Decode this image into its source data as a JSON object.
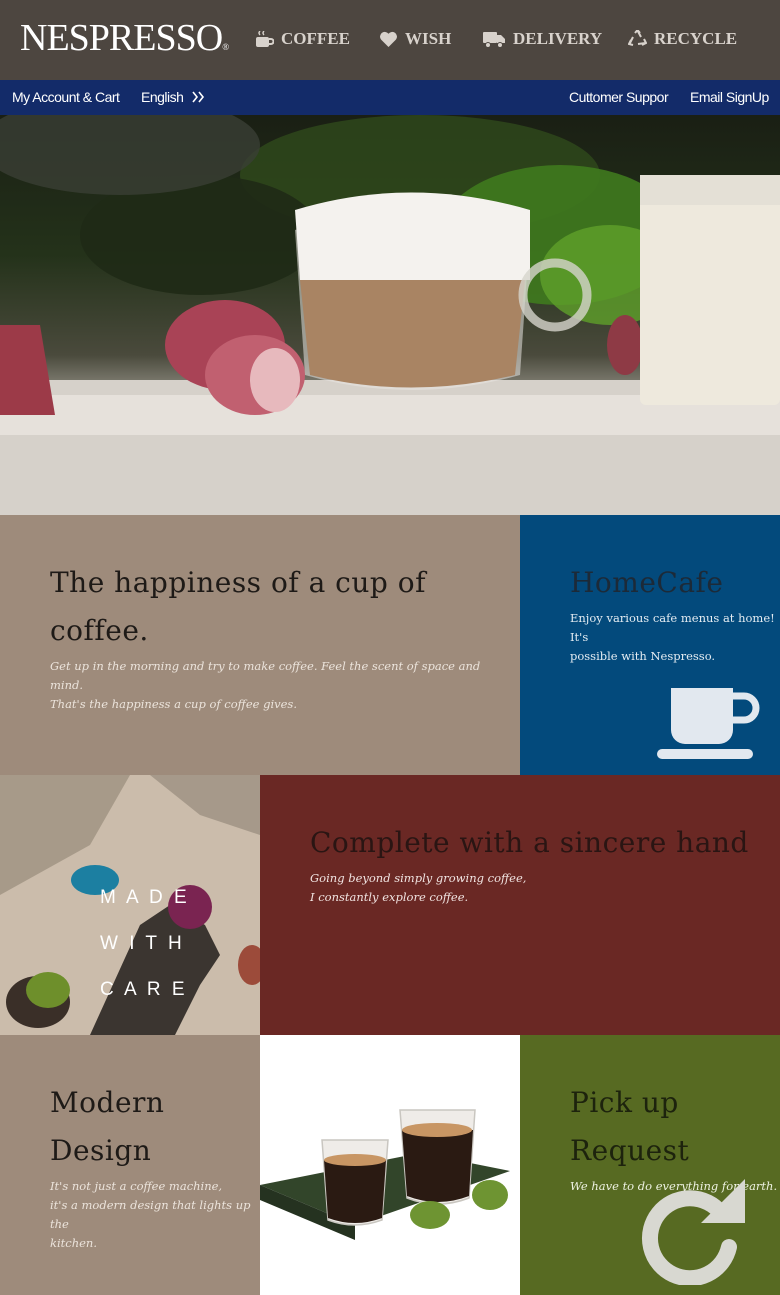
{
  "header": {
    "logo": "NESPRESSO",
    "logo_mark": "®",
    "nav": [
      {
        "label": "COFFEE",
        "icon": "coffee-cup-icon"
      },
      {
        "label": "WISH",
        "icon": "heart-icon"
      },
      {
        "label": "DELIVERY",
        "icon": "truck-icon"
      },
      {
        "label": "RECYCLE",
        "icon": "recycle-icon"
      }
    ]
  },
  "subbar": {
    "account": "My Account & Cart",
    "language": "English",
    "language_icon": "double-chevron-right-icon",
    "support": "Cuttomer Suppor",
    "signup": "Email SignUp"
  },
  "hero": {
    "alt_icon": "cappuccino-photo"
  },
  "tiles": {
    "happiness": {
      "title": "The happiness of a cup of coffee.",
      "text1": "Get up in the morning and try to make coffee. Feel the scent of space and mind.",
      "text2": "That's the happiness a cup of coffee gives.",
      "color": "#9e8b7b"
    },
    "homecafe": {
      "title": "HomeCafe",
      "text1": "Enjoy various cafe menus at home! It's",
      "text2": "possible with Nespresso.",
      "icon": "coffee-cup-icon",
      "color": "#034a7c"
    },
    "made_with_care": {
      "line1": "M A D E",
      "line2": "W I T H",
      "line3": "C A R E"
    },
    "sincere": {
      "title": "Complete with a sincere hand",
      "text1": "Going beyond simply growing coffee,",
      "text2": "I constantly explore coffee.",
      "color": "#6a2824"
    },
    "modern": {
      "title": "Modern Design",
      "text1": "It's not just a coffee machine,",
      "text2": "it's a modern design that lights up the",
      "text3": "kitchen.",
      "color": "#9e8b7b"
    },
    "pickup": {
      "title1": "Pick up",
      "title2": "Request",
      "text1": "We have to do everything for earth.",
      "icon": "redo-arrow-icon",
      "color": "#576a22"
    }
  }
}
